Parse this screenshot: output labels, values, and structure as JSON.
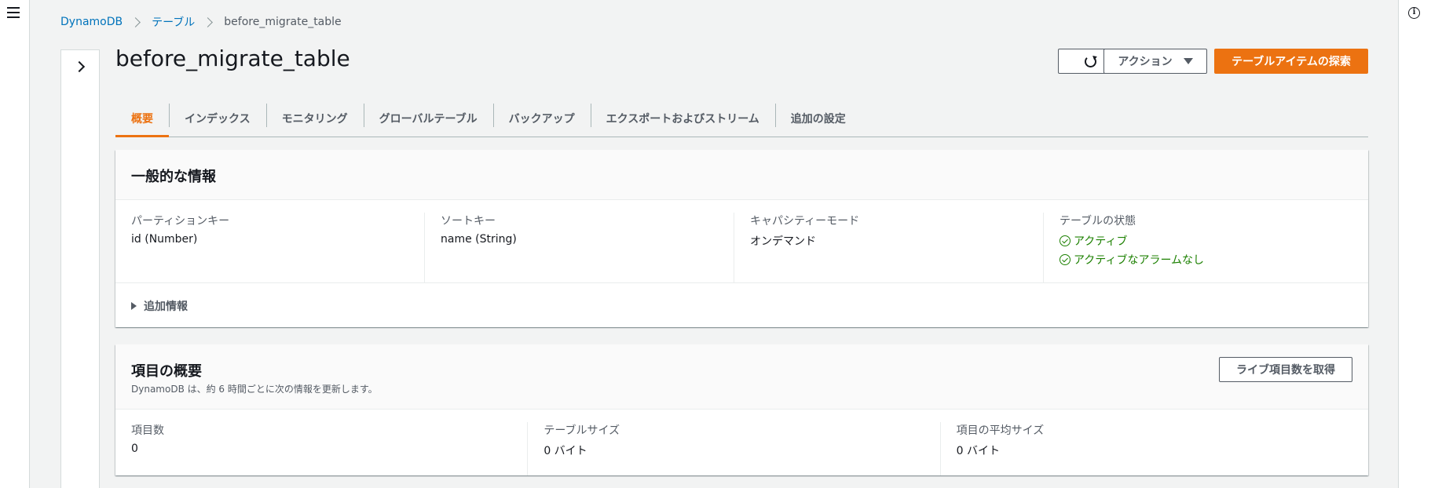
{
  "breadcrumb": {
    "items": [
      "DynamoDB",
      "テーブル",
      "before_migrate_table"
    ]
  },
  "page": {
    "title": "before_migrate_table"
  },
  "header_buttons": {
    "actions_label": "アクション",
    "explore_label": "テーブルアイテムの探索"
  },
  "tabs": [
    "概要",
    "インデックス",
    "モニタリング",
    "グローバルテーブル",
    "バックアップ",
    "エクスポートおよびストリーム",
    "追加の設定"
  ],
  "general_info": {
    "title": "一般的な情報",
    "partition_key_label": "パーティションキー",
    "partition_key_value": "id (Number)",
    "sort_key_label": "ソートキー",
    "sort_key_value": "name (String)",
    "capacity_mode_label": "キャパシティーモード",
    "capacity_mode_value": "オンデマンド",
    "table_status_label": "テーブルの状態",
    "table_status_value": "アクティブ",
    "alarm_status_value": "アクティブなアラームなし",
    "additional_info_label": "追加情報"
  },
  "item_summary": {
    "title": "項目の概要",
    "subtitle": "DynamoDB は、約 6 時間ごとに次の情報を更新します。",
    "live_count_button": "ライブ項目数を取得",
    "item_count_label": "項目数",
    "item_count_value": "0",
    "table_size_label": "テーブルサイズ",
    "table_size_value": "0 バイト",
    "avg_item_size_label": "項目の平均サイズ",
    "avg_item_size_value": "0 バイト"
  },
  "colors": {
    "accent": "#ec7211",
    "link": "#0073bb",
    "success": "#1d8102"
  }
}
